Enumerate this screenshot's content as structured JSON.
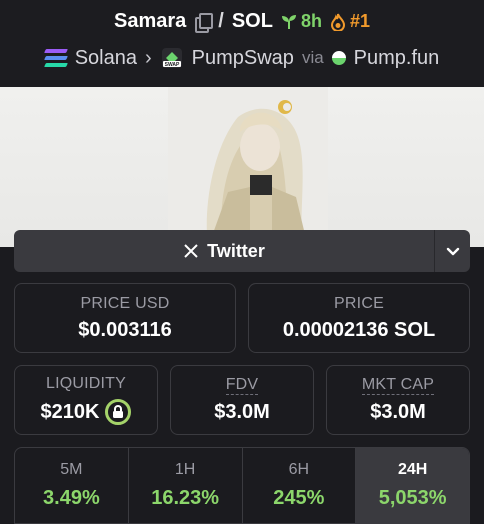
{
  "header": {
    "token_name": "Samara",
    "separator": "/",
    "quote": "SOL",
    "age": "8h",
    "rank": "#1"
  },
  "chain": {
    "network": "Solana",
    "dex": "PumpSwap",
    "via_label": "via",
    "launchpad": "Pump.fun"
  },
  "social": {
    "twitter_label": "Twitter"
  },
  "price": {
    "usd_label": "PRICE USD",
    "usd_value": "$0.003116",
    "native_label": "PRICE",
    "native_value": "0.00002136 SOL"
  },
  "stats": {
    "liquidity_label": "LIQUIDITY",
    "liquidity_value": "$210K",
    "fdv_label": "FDV",
    "fdv_value": "$3.0M",
    "mcap_label": "MKT CAP",
    "mcap_value": "$3.0M"
  },
  "timeframes": [
    {
      "label": "5M",
      "value": "3.49%"
    },
    {
      "label": "1H",
      "value": "16.23%"
    },
    {
      "label": "6H",
      "value": "245%"
    },
    {
      "label": "24H",
      "value": "5,053%"
    }
  ],
  "colors": {
    "positive": "#8cd66b",
    "age": "#7fd36a",
    "rank": "#f19a2c",
    "background": "#1b1b1f"
  }
}
